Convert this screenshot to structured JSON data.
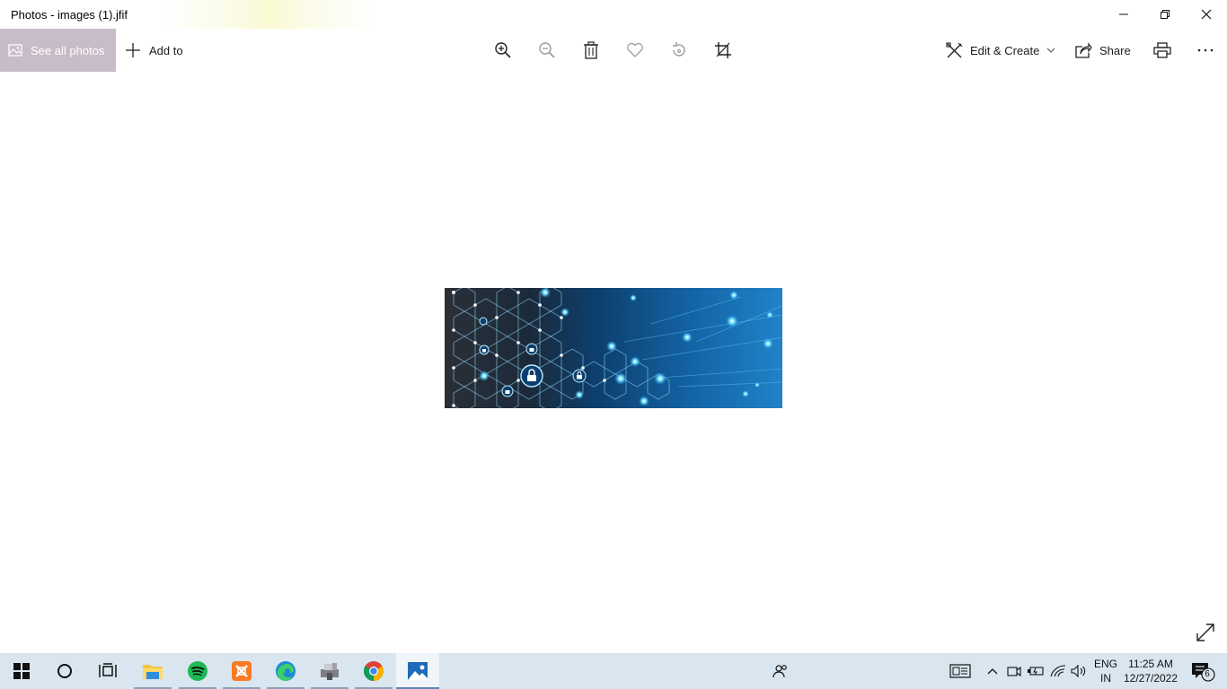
{
  "window": {
    "title": "Photos - images (1).jfif",
    "minimize_icon": "minimize-icon",
    "restore_icon": "restore-icon",
    "close_icon": "close-icon"
  },
  "toolbar": {
    "see_all_label": "See all photos",
    "add_to_label": "Add to",
    "center_icons": [
      "zoom-in-icon",
      "zoom-out-icon",
      "delete-icon",
      "favorite-icon",
      "rotate-icon",
      "crop-icon"
    ],
    "edit_create_label": "Edit & Create",
    "share_label": "Share",
    "print_icon": "print-icon",
    "more_icon": "more-icon"
  },
  "taskbar": {
    "apps": [
      "start",
      "cortana",
      "task-view",
      "file-explorer",
      "spotify",
      "xampp",
      "edge",
      "app-unknown",
      "chrome",
      "photos"
    ],
    "lang_line1": "ENG",
    "lang_line2": "IN",
    "time": "11:25 AM",
    "date": "12/27/2022",
    "notification_count": "6"
  },
  "colors": {
    "see_all_bg": "#c8bcc8",
    "taskbar_bg": "#d9e6ef",
    "accent": "#0078d7"
  }
}
